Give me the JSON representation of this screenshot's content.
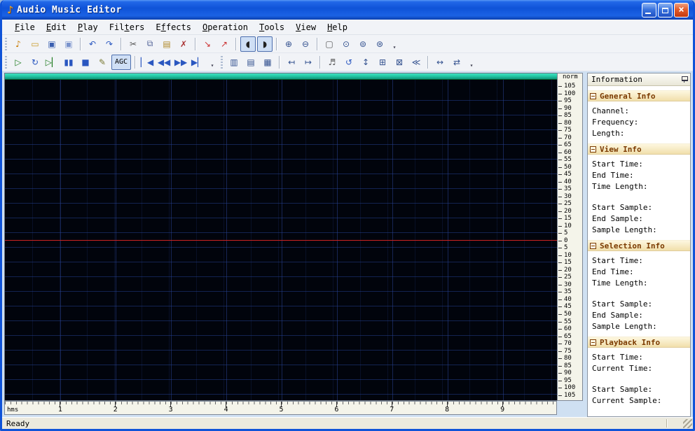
{
  "window": {
    "title": "Audio Music Editor",
    "icon_glyph": "♪",
    "controls": {
      "minimize": "minimize",
      "restore": "restore",
      "close": "×"
    }
  },
  "colors": {
    "frame": "#0f53d8",
    "win_bg": "#cfe0f2",
    "wave_bg": "#01040c",
    "overview": "#1fc3a0",
    "zero_line": "#cc2222",
    "pressed_bg": "#cfdff5",
    "pressed_border": "#4d6fae",
    "header_text": "#7b3a00"
  },
  "menu": {
    "items": [
      {
        "label": "File",
        "underline": 0
      },
      {
        "label": "Edit",
        "underline": 0
      },
      {
        "label": "Play",
        "underline": 0
      },
      {
        "label": "Filters",
        "underline": 3
      },
      {
        "label": "Effects",
        "underline": 1
      },
      {
        "label": "Operation",
        "underline": 0
      },
      {
        "label": "Tools",
        "underline": 0
      },
      {
        "label": "View",
        "underline": 0
      },
      {
        "label": "Help",
        "underline": 0
      }
    ]
  },
  "toolbars": [
    {
      "id": "main-toolbar",
      "groups": [
        [
          {
            "name": "new-file",
            "glyph": "♪",
            "color": "#c97b00"
          },
          {
            "name": "open-file",
            "glyph": "▭",
            "color": "#c99b2a"
          },
          {
            "name": "save-file",
            "glyph": "▣",
            "color": "#3a5fb0"
          },
          {
            "name": "save-file-as",
            "glyph": "▣",
            "color": "#7a93cc"
          }
        ],
        [
          {
            "name": "undo",
            "glyph": "↶",
            "color": "#2a57c0"
          },
          {
            "name": "redo",
            "glyph": "↷",
            "color": "#2a57c0"
          }
        ],
        [
          {
            "name": "cut",
            "glyph": "✂",
            "color": "#555555"
          },
          {
            "name": "copy",
            "glyph": "⧉",
            "color": "#556699"
          },
          {
            "name": "paste",
            "glyph": "▤",
            "color": "#b08a2a"
          },
          {
            "name": "delete",
            "glyph": "✗",
            "color": "#aa3333"
          }
        ],
        [
          {
            "name": "import-audio",
            "glyph": "↘",
            "color": "#cc3333"
          },
          {
            "name": "export-audio",
            "glyph": "↗",
            "color": "#cc3333"
          }
        ],
        [
          {
            "name": "left-channel-toggle",
            "glyph": "◖",
            "color": "#222222",
            "pressed": true
          },
          {
            "name": "right-channel-toggle",
            "glyph": "◗",
            "color": "#222222",
            "pressed": true
          }
        ],
        [
          {
            "name": "zoom-in",
            "glyph": "⊕",
            "color": "#33518f"
          },
          {
            "name": "zoom-out",
            "glyph": "⊖",
            "color": "#33518f"
          }
        ],
        [
          {
            "name": "select-region",
            "glyph": "▢",
            "color": "#555555"
          },
          {
            "name": "zoom-selection",
            "glyph": "⊙",
            "color": "#33518f"
          },
          {
            "name": "zoom-all",
            "glyph": "⊚",
            "color": "#33518f"
          },
          {
            "name": "zoom-one-to-one",
            "glyph": "⊛",
            "color": "#33518f"
          }
        ]
      ]
    },
    {
      "id": "playback-toolbar",
      "groups": [
        [
          {
            "name": "play",
            "glyph": "▷",
            "color": "#1c7a1c"
          },
          {
            "name": "loop-play",
            "glyph": "↻",
            "color": "#2a57c0"
          },
          {
            "name": "play-to-end",
            "glyph": "▷▏",
            "color": "#1c7a1c"
          },
          {
            "name": "pause",
            "glyph": "▮▮",
            "color": "#2a57c0"
          },
          {
            "name": "stop",
            "glyph": "■",
            "color": "#2a57c0"
          },
          {
            "name": "record-edit",
            "glyph": "✎",
            "color": "#7a7a33"
          },
          {
            "name": "agc-toggle",
            "text": "AGC",
            "pressed": true
          }
        ],
        [
          {
            "name": "go-to-start",
            "glyph": "▏◀",
            "color": "#2a57c0"
          },
          {
            "name": "rewind",
            "glyph": "◀◀",
            "color": "#2a57c0"
          },
          {
            "name": "fast-forward",
            "glyph": "▶▶",
            "color": "#2a57c0"
          },
          {
            "name": "go-to-end",
            "glyph": "▶▏",
            "color": "#2a57c0"
          }
        ]
      ]
    },
    {
      "id": "view-toolbar",
      "groups": [
        [
          {
            "name": "vertical-ruler-toggle",
            "glyph": "▥",
            "color": "#33518f"
          },
          {
            "name": "horizontal-ruler-toggle",
            "glyph": "▤",
            "color": "#33518f"
          },
          {
            "name": "grid-toggle",
            "glyph": "▦",
            "color": "#33518f"
          }
        ],
        [
          {
            "name": "snap-to-left",
            "glyph": "↤",
            "color": "#33518f"
          },
          {
            "name": "snap-to-right",
            "glyph": "↦",
            "color": "#33518f"
          }
        ],
        [
          {
            "name": "sync-playback",
            "glyph": "♬",
            "color": "#555555"
          },
          {
            "name": "refresh-view",
            "glyph": "↺",
            "color": "#2a57c0"
          },
          {
            "name": "fit-vertical",
            "glyph": "↕",
            "color": "#33518f"
          },
          {
            "name": "group-windows",
            "glyph": "⊞",
            "color": "#33518f"
          },
          {
            "name": "tile-windows",
            "glyph": "⊠",
            "color": "#33518f"
          },
          {
            "name": "scroll-to-cursor",
            "glyph": "≪",
            "color": "#33518f"
          }
        ],
        [
          {
            "name": "fit-horizontal",
            "glyph": "↔",
            "color": "#33518f"
          },
          {
            "name": "collapse-view",
            "glyph": "⇄",
            "color": "#33518f"
          }
        ]
      ]
    }
  ],
  "scale": {
    "top_label": "norm",
    "values": [
      "105",
      "100",
      "95",
      "90",
      "85",
      "80",
      "75",
      "70",
      "65",
      "60",
      "55",
      "50",
      "45",
      "40",
      "35",
      "30",
      "25",
      "20",
      "15",
      "10",
      "5",
      "0",
      "5",
      "10",
      "15",
      "20",
      "25",
      "30",
      "35",
      "40",
      "45",
      "50",
      "55",
      "60",
      "65",
      "70",
      "75",
      "80",
      "85",
      "90",
      "95",
      "100",
      "105"
    ]
  },
  "ruler": {
    "unit": "hms",
    "numbers": [
      "1",
      "2",
      "3",
      "4",
      "5",
      "6",
      "7",
      "8",
      "9"
    ]
  },
  "info_panel": {
    "title": "Information",
    "sections": [
      {
        "title": "General Info",
        "groups": [
          [
            "Channel:",
            "Frequency:",
            "Length:"
          ]
        ]
      },
      {
        "title": "View Info",
        "groups": [
          [
            "Start Time:",
            "End Time:",
            "Time Length:"
          ],
          [
            "Start Sample:",
            "End Sample:",
            "Sample Length:"
          ]
        ]
      },
      {
        "title": "Selection Info",
        "groups": [
          [
            "Start Time:",
            "End Time:",
            "Time Length:"
          ],
          [
            "Start Sample:",
            "End Sample:",
            "Sample Length:"
          ]
        ]
      },
      {
        "title": "Playback Info",
        "groups": [
          [
            "Start Time:",
            "Current Time:"
          ],
          [
            "Start Sample:",
            "Current Sample:"
          ]
        ]
      }
    ]
  },
  "status": {
    "text": "Ready"
  }
}
